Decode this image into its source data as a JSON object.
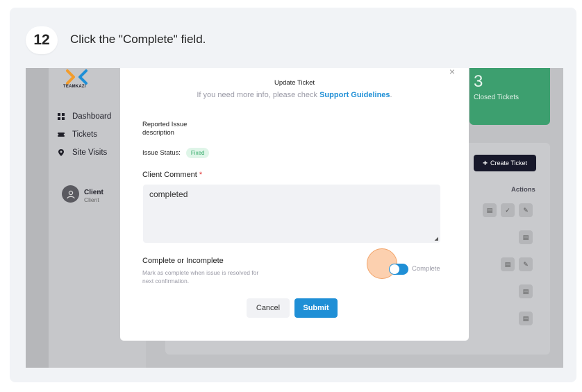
{
  "step": {
    "number": "12",
    "instruction": "Click the \"Complete\" field."
  },
  "sidebar": {
    "logo_text": "TEAMKAZI",
    "items": [
      {
        "label": "Dashboard",
        "icon": "grid-icon"
      },
      {
        "label": "Tickets",
        "icon": "ticket-icon"
      },
      {
        "label": "Site Visits",
        "icon": "map-pin-icon"
      }
    ],
    "user": {
      "name": "Client",
      "role": "Client"
    }
  },
  "stats": {
    "closed_count": "3",
    "closed_label": "Closed Tickets"
  },
  "table": {
    "create_button": "Create Ticket",
    "actions_header": "Actions"
  },
  "modal": {
    "title": "Update Ticket",
    "subtitle_prefix": "If you need more info, please check ",
    "subtitle_link": "Support Guidelines",
    "subtitle_suffix": ".",
    "reported_issue_label": "Reported Issue",
    "reported_issue_value": "description",
    "issue_status_label": "Issue Status:",
    "issue_status_value": "Fixed",
    "client_comment_label": "Client Comment",
    "required_mark": "*",
    "client_comment_value": "completed",
    "complete_title": "Complete or Incomplete",
    "complete_desc": "Mark as complete when issue is resolved for next confirmation.",
    "toggle_label": "Complete",
    "toggle_on": true,
    "cancel_label": "Cancel",
    "submit_label": "Submit"
  },
  "colors": {
    "accent_blue": "#1f8fd6",
    "green_card": "#3d9f6f",
    "highlight": "#f2a46a",
    "fixed_badge_text": "#2fa866"
  }
}
